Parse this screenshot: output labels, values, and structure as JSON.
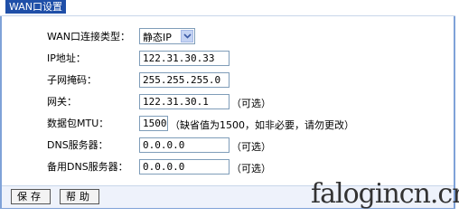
{
  "window": {
    "title": "WAN口设置"
  },
  "form": {
    "conn_type_label": "WAN口连接类型：",
    "conn_type_value": "静态IP",
    "ip_label": "IP地址：",
    "ip_value": "122.31.30.33",
    "mask_label": "子网掩码：",
    "mask_value": "255.255.255.0",
    "gateway_label": "网关：",
    "gateway_value": "122.31.30.1",
    "gateway_hint": "（可选）",
    "mtu_label": "数据包MTU：",
    "mtu_value": "1500",
    "mtu_hint": "（缺省值为1500，如非必要，请勿更改）",
    "dns_label": "DNS服务器：",
    "dns_value": "0.0.0.0",
    "dns_hint": "（可选）",
    "alt_dns_label": "备用DNS服务器：",
    "alt_dns_value": "0.0.0.0",
    "alt_dns_hint": "（可选）"
  },
  "buttons": {
    "save": "保存",
    "help": "帮助"
  },
  "watermark": "falogincn.cn",
  "icons": {
    "dropdown": "chevron-down-icon"
  }
}
